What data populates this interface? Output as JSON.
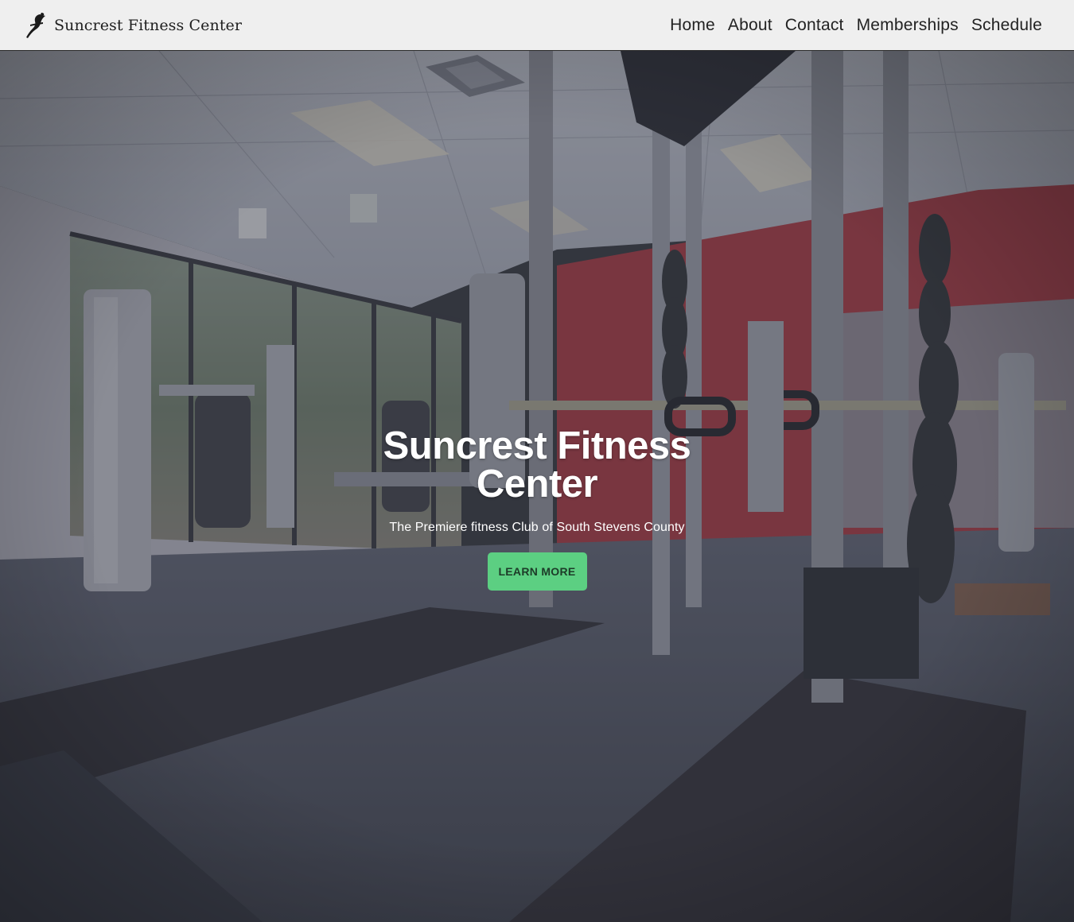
{
  "site": {
    "brand_name": "Suncrest Fitness Center",
    "logo_icon": "runner-logo-icon"
  },
  "nav": {
    "links": [
      {
        "label": "Home"
      },
      {
        "label": "About"
      },
      {
        "label": "Contact"
      },
      {
        "label": "Memberships"
      },
      {
        "label": "Schedule"
      }
    ]
  },
  "hero": {
    "title": "Suncrest Fitness Center",
    "subtitle": "The Premiere fitness Club of South Stevens County",
    "button_label": "LEARN MORE",
    "background": "gym-interior-photo"
  },
  "colors": {
    "navbar_bg": "#efefef",
    "accent_button": "#5ccf82",
    "hero_overlay": "#3a3d4a",
    "accent_wall": "#b82a33"
  }
}
